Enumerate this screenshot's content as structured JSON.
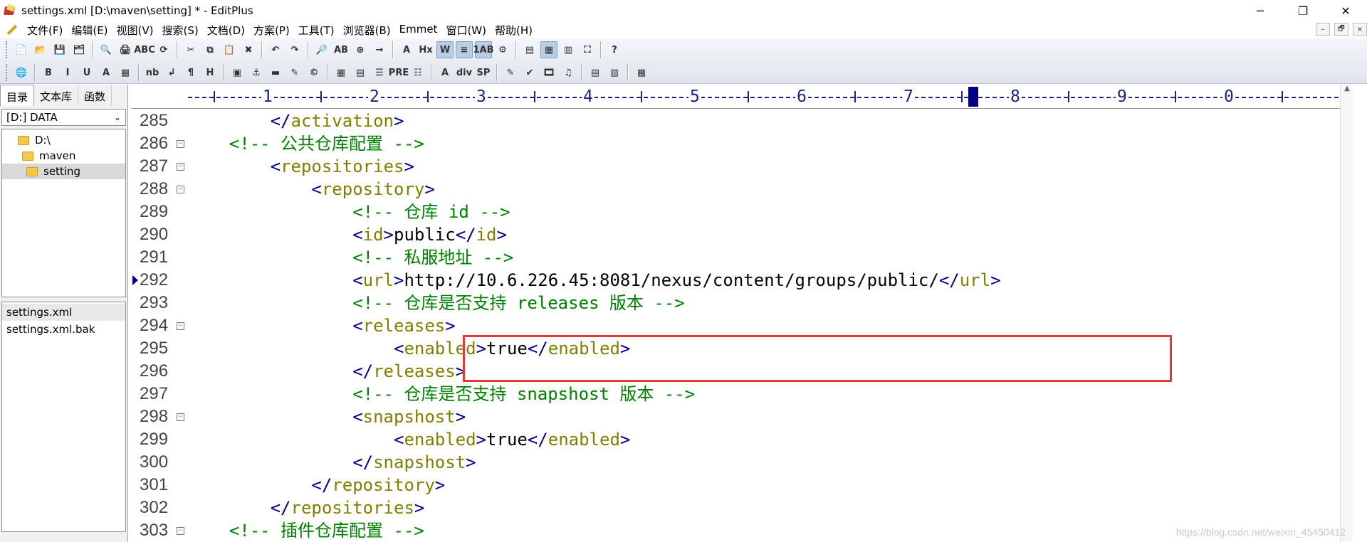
{
  "window": {
    "title": "settings.xml [D:\\maven\\setting] * - EditPlus",
    "controls": {
      "minimize": "─",
      "restore": "❐",
      "close": "✕"
    }
  },
  "menu": {
    "items": [
      "文件(F)",
      "编辑(E)",
      "视图(V)",
      "搜索(S)",
      "文档(D)",
      "方案(P)",
      "工具(T)",
      "浏览器(B)",
      "Emmet",
      "窗口(W)",
      "帮助(H)"
    ],
    "mdi": {
      "minimize": "–",
      "restore": "🗗",
      "close": "×"
    }
  },
  "toolbar": {
    "row1": [
      {
        "name": "new-file-icon",
        "glyph": "📄"
      },
      {
        "name": "open-file-icon",
        "glyph": "📂"
      },
      {
        "name": "save-icon",
        "glyph": "💾"
      },
      {
        "name": "save-all-icon",
        "glyph": "🗂"
      },
      {
        "sep": true
      },
      {
        "name": "print-preview-icon",
        "glyph": "🔍"
      },
      {
        "name": "print-icon",
        "glyph": "🖨"
      },
      {
        "name": "spell-check-icon",
        "glyph": "ABC"
      },
      {
        "name": "refresh-icon",
        "glyph": "⟳"
      },
      {
        "sep": true
      },
      {
        "name": "cut-icon",
        "glyph": "✂"
      },
      {
        "name": "copy-icon",
        "glyph": "⧉"
      },
      {
        "name": "paste-icon",
        "glyph": "📋"
      },
      {
        "name": "delete-icon",
        "glyph": "✖"
      },
      {
        "sep": true
      },
      {
        "name": "undo-icon",
        "glyph": "↶"
      },
      {
        "name": "redo-icon",
        "glyph": "↷"
      },
      {
        "sep": true
      },
      {
        "name": "find-icon",
        "glyph": "🔎"
      },
      {
        "name": "replace-icon",
        "glyph": "AB"
      },
      {
        "name": "find-in-files-icon",
        "glyph": "⊕"
      },
      {
        "name": "goto-icon",
        "glyph": "→"
      },
      {
        "sep": true
      },
      {
        "name": "font-icon",
        "glyph": "A"
      },
      {
        "name": "hex-icon",
        "glyph": "Hx"
      },
      {
        "name": "word-wrap-icon",
        "glyph": "W",
        "pressed": true
      },
      {
        "name": "line-number-icon",
        "glyph": "≡",
        "pressed": true
      },
      {
        "name": "ruler-icon",
        "glyph": "1AB",
        "pressed": true
      },
      {
        "name": "settings-icon",
        "glyph": "⚙"
      },
      {
        "sep": true
      },
      {
        "name": "directory-window-icon",
        "glyph": "▤"
      },
      {
        "name": "output-window-icon",
        "glyph": "▦",
        "pressed": true
      },
      {
        "name": "cliptext-icon",
        "glyph": "▥"
      },
      {
        "name": "fullscreen-icon",
        "glyph": "⛶"
      },
      {
        "sep": true
      },
      {
        "name": "help-icon",
        "glyph": "?"
      }
    ],
    "row2": [
      {
        "name": "browser-icon",
        "glyph": "🌐"
      },
      {
        "sep": true
      },
      {
        "name": "bold-icon",
        "glyph": "B"
      },
      {
        "name": "italic-icon",
        "glyph": "I"
      },
      {
        "name": "underline-icon",
        "glyph": "U"
      },
      {
        "name": "font-color-icon",
        "glyph": "A"
      },
      {
        "name": "color-picker-icon",
        "glyph": "▦"
      },
      {
        "sep": true
      },
      {
        "name": "nbsp-icon",
        "glyph": "nb"
      },
      {
        "name": "line-break-icon",
        "glyph": "↲"
      },
      {
        "name": "paragraph-icon",
        "glyph": "¶"
      },
      {
        "name": "heading-icon",
        "glyph": "H"
      },
      {
        "sep": true
      },
      {
        "name": "image-icon",
        "glyph": "▣"
      },
      {
        "name": "anchor-icon",
        "glyph": "⚓"
      },
      {
        "name": "hr-icon",
        "glyph": "▬"
      },
      {
        "name": "comment-icon",
        "glyph": "✎"
      },
      {
        "name": "copyright-icon",
        "glyph": "©"
      },
      {
        "sep": true
      },
      {
        "name": "table-icon",
        "glyph": "▦"
      },
      {
        "name": "form-icon",
        "glyph": "▤"
      },
      {
        "name": "center-icon",
        "glyph": "☰"
      },
      {
        "name": "pre-icon",
        "glyph": "PRE"
      },
      {
        "name": "list-icon",
        "glyph": "☷"
      },
      {
        "sep": true
      },
      {
        "name": "text-area-icon",
        "glyph": "A"
      },
      {
        "name": "div-icon",
        "glyph": "div"
      },
      {
        "name": "span-icon",
        "glyph": "SP"
      },
      {
        "sep": true
      },
      {
        "name": "edit-icon",
        "glyph": "✎"
      },
      {
        "name": "validate-icon",
        "glyph": "✔"
      },
      {
        "name": "media-icon",
        "glyph": "🎞"
      },
      {
        "name": "music-icon",
        "glyph": "♫"
      },
      {
        "sep": true
      },
      {
        "name": "panel-icon",
        "glyph": "▤"
      },
      {
        "name": "panel2-icon",
        "glyph": "▥"
      },
      {
        "sep": true
      },
      {
        "name": "color-grid-icon",
        "glyph": "▦"
      }
    ]
  },
  "sidebar": {
    "tabs": [
      "目录",
      "文本库",
      "函数"
    ],
    "drive": "[D:] DATA",
    "tree": [
      {
        "label": "D:\\",
        "indent": 0
      },
      {
        "label": "maven",
        "indent": 1
      },
      {
        "label": "setting",
        "indent": 2,
        "selected": true
      }
    ],
    "files": [
      {
        "label": "settings.xml",
        "selected": true
      },
      {
        "label": "settings.xml.bak"
      }
    ]
  },
  "ruler": {
    "numbers": [
      "1",
      "2",
      "3",
      "4",
      "5",
      "6",
      "7",
      "8",
      "9",
      "0"
    ]
  },
  "editor": {
    "lines": [
      {
        "n": "285",
        "fold": false,
        "tokens": [
          [
            "        ",
            "t"
          ],
          [
            "</",
            "tag"
          ],
          [
            "activation",
            "name"
          ],
          [
            ">",
            "tag"
          ]
        ]
      },
      {
        "n": "286",
        "fold": true,
        "tokens": [
          [
            "    ",
            "t"
          ],
          [
            "<!-- 公共仓库配置 -->",
            "comment"
          ]
        ]
      },
      {
        "n": "287",
        "fold": true,
        "tokens": [
          [
            "        ",
            "t"
          ],
          [
            "<",
            "tag"
          ],
          [
            "repositories",
            "name"
          ],
          [
            ">",
            "tag"
          ]
        ]
      },
      {
        "n": "288",
        "fold": true,
        "tokens": [
          [
            "            ",
            "t"
          ],
          [
            "<",
            "tag"
          ],
          [
            "repository",
            "name"
          ],
          [
            ">",
            "tag"
          ]
        ]
      },
      {
        "n": "289",
        "fold": false,
        "tokens": [
          [
            "                ",
            "t"
          ],
          [
            "<!-- 仓库 id -->",
            "comment"
          ]
        ]
      },
      {
        "n": "290",
        "fold": false,
        "tokens": [
          [
            "                ",
            "t"
          ],
          [
            "<",
            "tag"
          ],
          [
            "id",
            "name"
          ],
          [
            ">",
            "tag"
          ],
          [
            "public",
            "text"
          ],
          [
            "</",
            "tag"
          ],
          [
            "id",
            "name"
          ],
          [
            ">",
            "tag"
          ]
        ]
      },
      {
        "n": "291",
        "fold": false,
        "tokens": [
          [
            "                ",
            "t"
          ],
          [
            "<!-- 私服地址 -->",
            "comment"
          ]
        ]
      },
      {
        "n": "292",
        "fold": false,
        "current": true,
        "tokens": [
          [
            "                ",
            "t"
          ],
          [
            "<",
            "tag"
          ],
          [
            "url",
            "name"
          ],
          [
            ">",
            "tag"
          ],
          [
            "http://10.6.226.45:8081/nexus/content/groups/public/",
            "text"
          ],
          [
            "</",
            "tag"
          ],
          [
            "url",
            "name"
          ],
          [
            ">",
            "tag"
          ]
        ]
      },
      {
        "n": "293",
        "fold": false,
        "tokens": [
          [
            "                ",
            "t"
          ],
          [
            "<!-- 仓库是否支持 releases 版本 -->",
            "comment"
          ]
        ]
      },
      {
        "n": "294",
        "fold": true,
        "tokens": [
          [
            "                ",
            "t"
          ],
          [
            "<",
            "tag"
          ],
          [
            "releases",
            "name"
          ],
          [
            ">",
            "tag"
          ]
        ]
      },
      {
        "n": "295",
        "fold": false,
        "tokens": [
          [
            "                    ",
            "t"
          ],
          [
            "<",
            "tag"
          ],
          [
            "enabled",
            "name"
          ],
          [
            ">",
            "tag"
          ],
          [
            "true",
            "text"
          ],
          [
            "</",
            "tag"
          ],
          [
            "enabled",
            "name"
          ],
          [
            ">",
            "tag"
          ]
        ]
      },
      {
        "n": "296",
        "fold": false,
        "tokens": [
          [
            "                ",
            "t"
          ],
          [
            "</",
            "tag"
          ],
          [
            "releases",
            "name"
          ],
          [
            ">",
            "tag"
          ]
        ]
      },
      {
        "n": "297",
        "fold": false,
        "tokens": [
          [
            "                ",
            "t"
          ],
          [
            "<!-- 仓库是否支持 snapshost 版本 -->",
            "comment"
          ]
        ]
      },
      {
        "n": "298",
        "fold": true,
        "tokens": [
          [
            "                ",
            "t"
          ],
          [
            "<",
            "tag"
          ],
          [
            "snapshost",
            "name"
          ],
          [
            ">",
            "tag"
          ]
        ]
      },
      {
        "n": "299",
        "fold": false,
        "tokens": [
          [
            "                    ",
            "t"
          ],
          [
            "<",
            "tag"
          ],
          [
            "enabled",
            "name"
          ],
          [
            ">",
            "tag"
          ],
          [
            "true",
            "text"
          ],
          [
            "</",
            "tag"
          ],
          [
            "enabled",
            "name"
          ],
          [
            ">",
            "tag"
          ]
        ]
      },
      {
        "n": "300",
        "fold": false,
        "tokens": [
          [
            "                ",
            "t"
          ],
          [
            "</",
            "tag"
          ],
          [
            "snapshost",
            "name"
          ],
          [
            ">",
            "tag"
          ]
        ]
      },
      {
        "n": "301",
        "fold": false,
        "tokens": [
          [
            "            ",
            "t"
          ],
          [
            "</",
            "tag"
          ],
          [
            "repository",
            "name"
          ],
          [
            ">",
            "tag"
          ]
        ]
      },
      {
        "n": "302",
        "fold": false,
        "tokens": [
          [
            "        ",
            "t"
          ],
          [
            "</",
            "tag"
          ],
          [
            "repositories",
            "name"
          ],
          [
            ">",
            "tag"
          ]
        ]
      },
      {
        "n": "303",
        "fold": true,
        "tokens": [
          [
            "    ",
            "t"
          ],
          [
            "<!-- 插件仓库配置 -->",
            "comment"
          ]
        ]
      }
    ]
  },
  "watermark": "https://blog.csdn.net/weixin_45450412",
  "colors": {
    "tag": "#00008b",
    "tag_name": "#808000",
    "comment": "#008000",
    "highlight_box": "#e53935",
    "ruler": "#1a237e"
  }
}
